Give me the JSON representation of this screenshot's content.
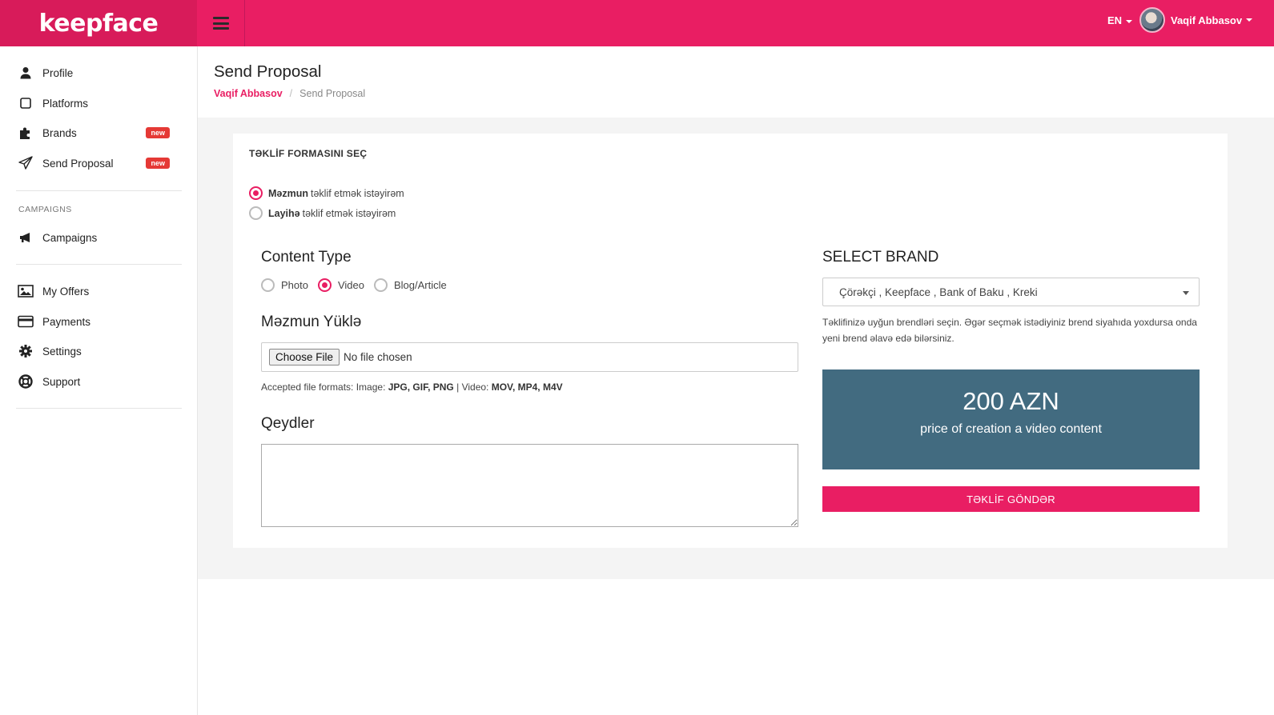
{
  "topbar": {
    "logo": "keepface",
    "language": "EN",
    "user_name": "Vaqif Abbasov"
  },
  "sidebar": {
    "items_top": [
      {
        "label": "Profile",
        "icon": "user-icon"
      },
      {
        "label": "Platforms",
        "icon": "square-icon"
      },
      {
        "label": "Brands",
        "icon": "puzzle-icon",
        "badge": "new"
      },
      {
        "label": "Send Proposal",
        "icon": "paper-plane-icon",
        "badge": "new"
      }
    ],
    "campaigns_heading": "CAMPAIGNS",
    "campaigns_item": {
      "label": "Campaigns",
      "icon": "megaphone-icon"
    },
    "items_bottom": [
      {
        "label": "My Offers",
        "icon": "image-icon"
      },
      {
        "label": "Payments",
        "icon": "credit-card-icon"
      },
      {
        "label": "Settings",
        "icon": "gear-icon"
      },
      {
        "label": "Support",
        "icon": "lifebuoy-icon"
      }
    ]
  },
  "header": {
    "title": "Send Proposal",
    "breadcrumb": {
      "home": "Vaqif Abbasov",
      "current": "Send Proposal"
    }
  },
  "form": {
    "choose_form_title": "TƏKLİF FORMASINI SEÇ",
    "form_options": [
      {
        "bold": "Məzmun",
        "rest": "təklif etmək istəyirəm",
        "selected": true
      },
      {
        "bold": "Layihə",
        "rest": "təklif etmək istəyirəm",
        "selected": false
      }
    ],
    "content_type_title": "Content Type",
    "content_types": [
      {
        "label": "Photo",
        "selected": false
      },
      {
        "label": "Video",
        "selected": true
      },
      {
        "label": "Blog/Article",
        "selected": false
      }
    ],
    "upload_title": "Məzmun Yüklə",
    "file_button": "Choose File",
    "file_status": "No file chosen",
    "file_hint": {
      "prefix": "Accepted file formats: Image: ",
      "image_formats": "JPG, GIF, PNG",
      "separator": " | Video: ",
      "video_formats": "MOV, MP4, M4V"
    },
    "notes_title": "Qeydler",
    "notes_value": "",
    "select_brand_title": "SELECT BRAND",
    "selected_brands": "Çörəkçi , Keepface , Bank of Baku , Kreki",
    "brand_help": "Təklifinizə uyğun brendləri seçin. Əgər seçmək istədiyiniz brend siyahıda yoxdursa onda yeni brend əlavə edə bilərsiniz.",
    "price_amount": "200 AZN",
    "price_caption": "price of creation a video content",
    "submit_label": "TƏKLİF GÖNDƏR"
  },
  "colors": {
    "accent": "#e91e63",
    "brand_dark": "#d81b5a",
    "price_box": "#426b80",
    "badge": "#e53935"
  }
}
